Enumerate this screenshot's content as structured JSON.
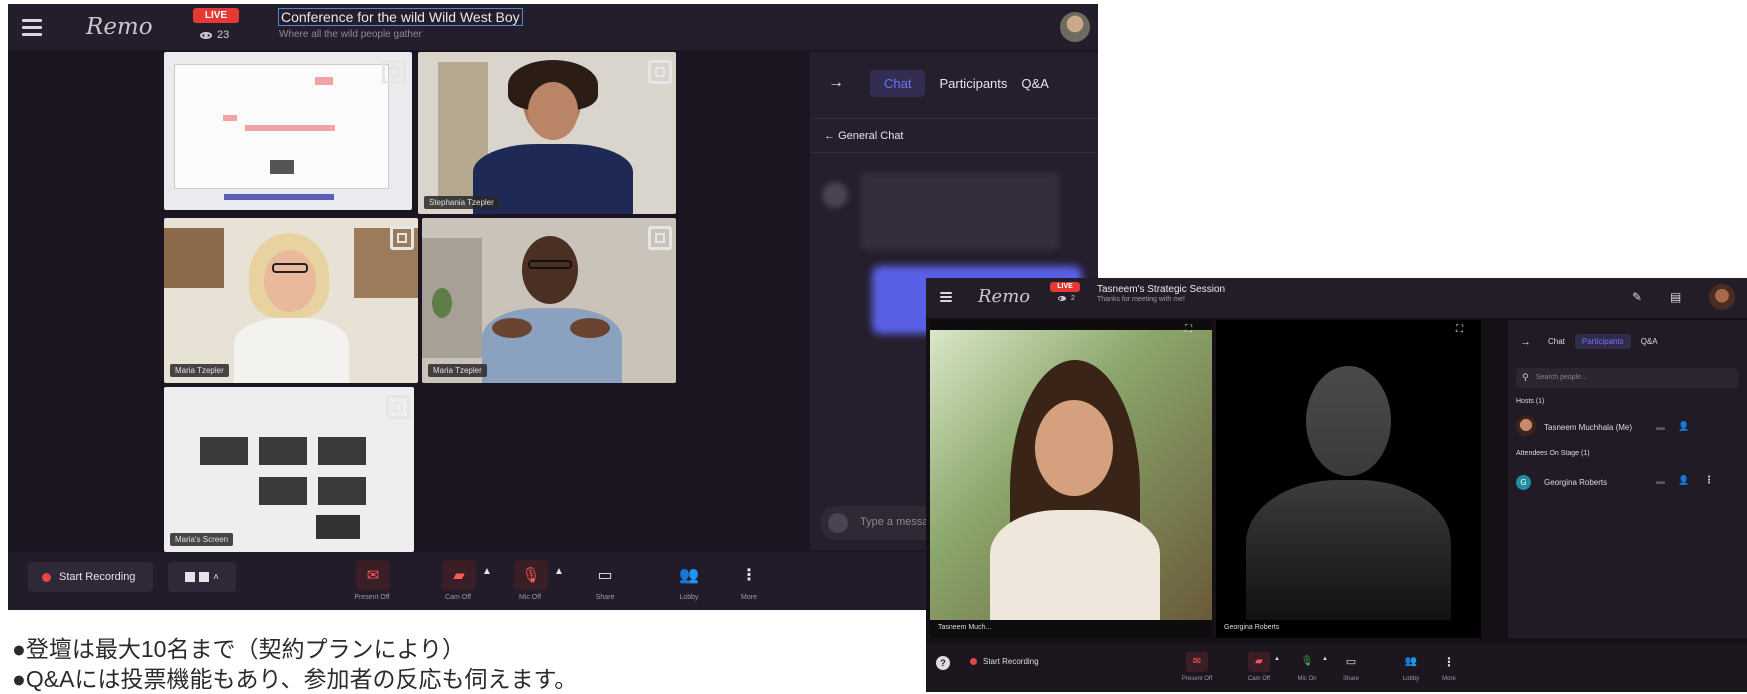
{
  "screen1": {
    "logo": "Remo",
    "live": "LIVE",
    "viewers": "23",
    "event_title": "Conference for the wild Wild West Boy",
    "event_subtitle": "Where all the wild people gather",
    "tiles": [
      {
        "label": ""
      },
      {
        "label": "Stephania Tzepler"
      },
      {
        "label": "Maria Tzepler"
      },
      {
        "label": "Maria Tzepler"
      },
      {
        "label": "Maria's Screen"
      }
    ],
    "tabs": [
      "Chat",
      "Participants",
      "Q&A"
    ],
    "chat_back": "General Chat",
    "chat_placeholder": "Type a messa",
    "start_recording": "Start Recording",
    "controls": [
      "Present Off",
      "Cam Off",
      "Mic Off",
      "Share",
      "Lobby",
      "More"
    ]
  },
  "screen2": {
    "logo": "Remo",
    "live": "LIVE",
    "viewers": "2",
    "event_title": "Tasneem's Strategic Session",
    "event_subtitle": "Thanks for meeting with me!",
    "video_labels": [
      "Tasneem Much...",
      "Georgina Roberts"
    ],
    "tabs": [
      "Chat",
      "Participants",
      "Q&A"
    ],
    "search_placeholder": "Search people...",
    "hosts_header": "Hosts (1)",
    "host_name": "Tasneem Muchhala (Me)",
    "attendees_header": "Attendees On Stage (1)",
    "attendee_initial": "G",
    "attendee_name": "Georgina Roberts",
    "start_recording": "Start Recording",
    "controls": [
      "Present Off",
      "Cam Off",
      "Mic On",
      "Share",
      "Lobby",
      "More"
    ]
  },
  "caption": [
    "●登壇は最大10名まで（契約プランにより）",
    "●Q&Aには投票機能もあり、参加者の反応も伺えます。"
  ],
  "colors": {
    "accent": "#6d73ff",
    "live": "#e53935",
    "record": "#e64545",
    "mic_on": "#4caf50"
  }
}
